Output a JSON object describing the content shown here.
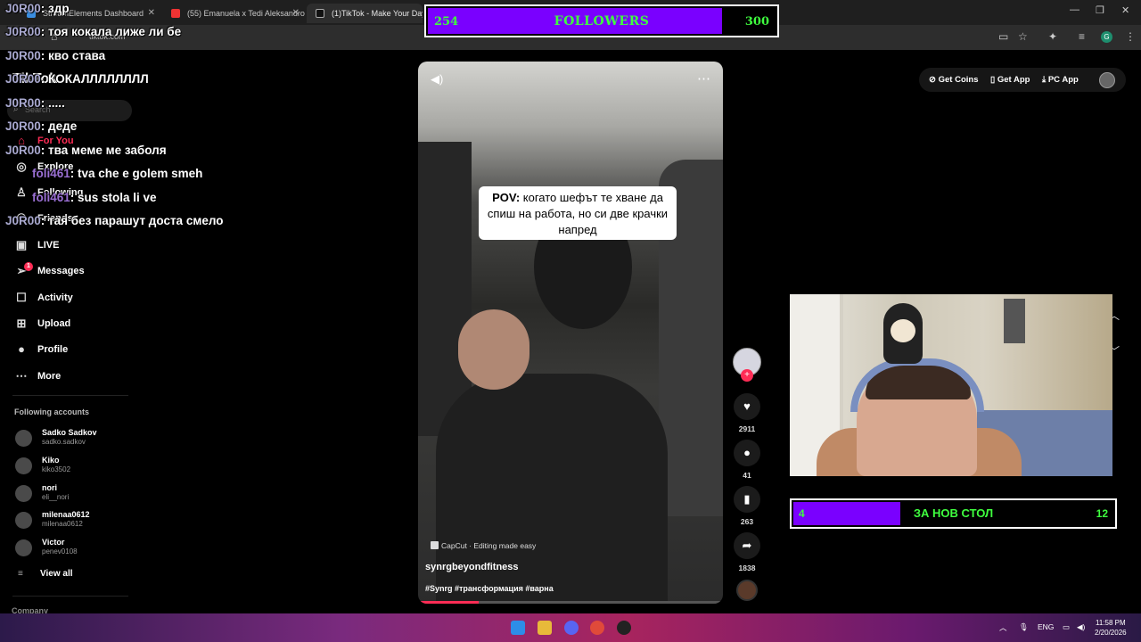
{
  "browser": {
    "tabs": [
      {
        "label": "StreamElements Dashboard",
        "active": false
      },
      {
        "label": "(55) Emanuela x Tedi Aleksandrova",
        "active": false
      },
      {
        "label": "(1)TikTok - Make Your Day",
        "active": true
      }
    ],
    "url": "tiktok.com"
  },
  "followers_goal": {
    "current": "254",
    "title": "FOLLOWERS",
    "target": "300",
    "progress": 0.847
  },
  "chat": [
    {
      "user": "J0R00",
      "msg": ": здр",
      "color": "u1"
    },
    {
      "user": "J0R00",
      "msg": ": тоя кокала лиже ли бе",
      "color": "u1"
    },
    {
      "user": "J0R00",
      "msg": ": кво става",
      "color": "u1"
    },
    {
      "user": "J0R00",
      "msg": ": КОКАЛЛЛЛЛЛЛЛ",
      "color": "u1"
    },
    {
      "user": "J0R00",
      "msg": ": .....",
      "color": "u1"
    },
    {
      "user": "J0R00",
      "msg": ": деде",
      "color": "u1"
    },
    {
      "user": "J0R00",
      "msg": ": тва меме ме заболя",
      "color": "u1"
    },
    {
      "user": "foli461",
      "msg": ": tva che e golem smeh",
      "color": "u2"
    },
    {
      "user": "foli461",
      "msg": ": sus stola li ve",
      "color": "u2"
    },
    {
      "user": "J0R00",
      "msg": ": тая без парашут доста смело",
      "color": "u1"
    }
  ],
  "sidebar": {
    "search_placeholder": "Search",
    "nav": [
      {
        "label": "For You",
        "icon": "home-icon",
        "active": true
      },
      {
        "label": "Explore",
        "icon": "compass-icon",
        "active": false
      },
      {
        "label": "Following",
        "icon": "following-icon",
        "active": false
      },
      {
        "label": "Friends",
        "icon": "friends-icon",
        "active": false
      },
      {
        "label": "LIVE",
        "icon": "live-icon",
        "active": false
      },
      {
        "label": "Messages",
        "icon": "messages-icon",
        "active": false,
        "badge": "1"
      },
      {
        "label": "Activity",
        "icon": "activity-icon",
        "active": false
      },
      {
        "label": "Upload",
        "icon": "upload-icon",
        "active": false
      },
      {
        "label": "Profile",
        "icon": "profile-icon",
        "active": false
      },
      {
        "label": "More",
        "icon": "more-icon",
        "active": false
      }
    ],
    "following_heading": "Following accounts",
    "accounts": [
      {
        "name": "Sadko Sadkov",
        "handle": "sadko.sadkov"
      },
      {
        "name": "Kiko",
        "handle": "kiko3502"
      },
      {
        "name": "nori",
        "handle": "eli__nori"
      },
      {
        "name": "milenaa0612",
        "handle": "milenaa0612"
      },
      {
        "name": "Victor",
        "handle": "penev0108"
      }
    ],
    "view_all": "View all",
    "company": "Company"
  },
  "top_actions": {
    "coins": "Get Coins",
    "app": "Get App",
    "pc": "PC App"
  },
  "video": {
    "caption_bold": "POV:",
    "caption_rest": "когато шефът те хване да спиш на работа, но си две крачки напред",
    "capcut": "CapCut · Editing made easy",
    "username": "synrgbeyondfitness",
    "tags": "#Synrg #трансформация #варна",
    "progress": 0.2
  },
  "actions": {
    "likes": "2911",
    "comments": "41",
    "saves": "263",
    "shares": "1838"
  },
  "table_goal": {
    "current": "4",
    "title": "ЗА НОВ СТОЛ",
    "target": "12",
    "progress": 0.333
  },
  "taskbar": {
    "lang": "ENG",
    "time": "11:58 PM",
    "date": "2/20/2026"
  },
  "colors": {
    "accent": "#fe2c55",
    "goal_fill": "#7a00ff",
    "goal_text": "#3fff3f"
  }
}
